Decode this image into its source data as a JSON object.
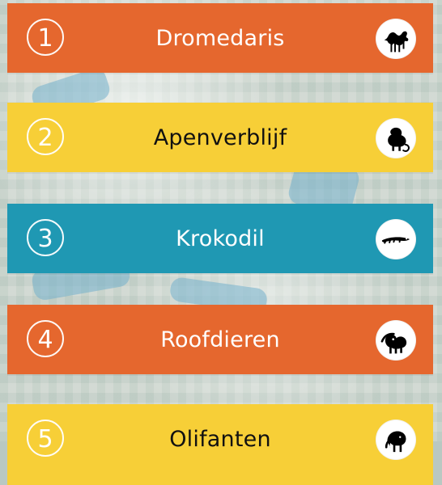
{
  "colors": {
    "orange": "#e5672e",
    "yellow": "#f7cf37",
    "teal": "#1f98b3"
  },
  "items": [
    {
      "number": "1",
      "label": "Dromedaris",
      "icon": "camel-icon",
      "color": "#e5672e",
      "text_color": "#ffffff"
    },
    {
      "number": "2",
      "label": "Apenverblijf",
      "icon": "monkey-icon",
      "color": "#f7cf37",
      "text_color": "#111111"
    },
    {
      "number": "3",
      "label": "Krokodil",
      "icon": "crocodile-icon",
      "color": "#1f98b3",
      "text_color": "#ffffff"
    },
    {
      "number": "4",
      "label": "Roofdieren",
      "icon": "lion-icon",
      "color": "#e5672e",
      "text_color": "#ffffff"
    },
    {
      "number": "5",
      "label": "Olifanten",
      "icon": "elephant-icon",
      "color": "#f7cf37",
      "text_color": "#111111"
    }
  ]
}
